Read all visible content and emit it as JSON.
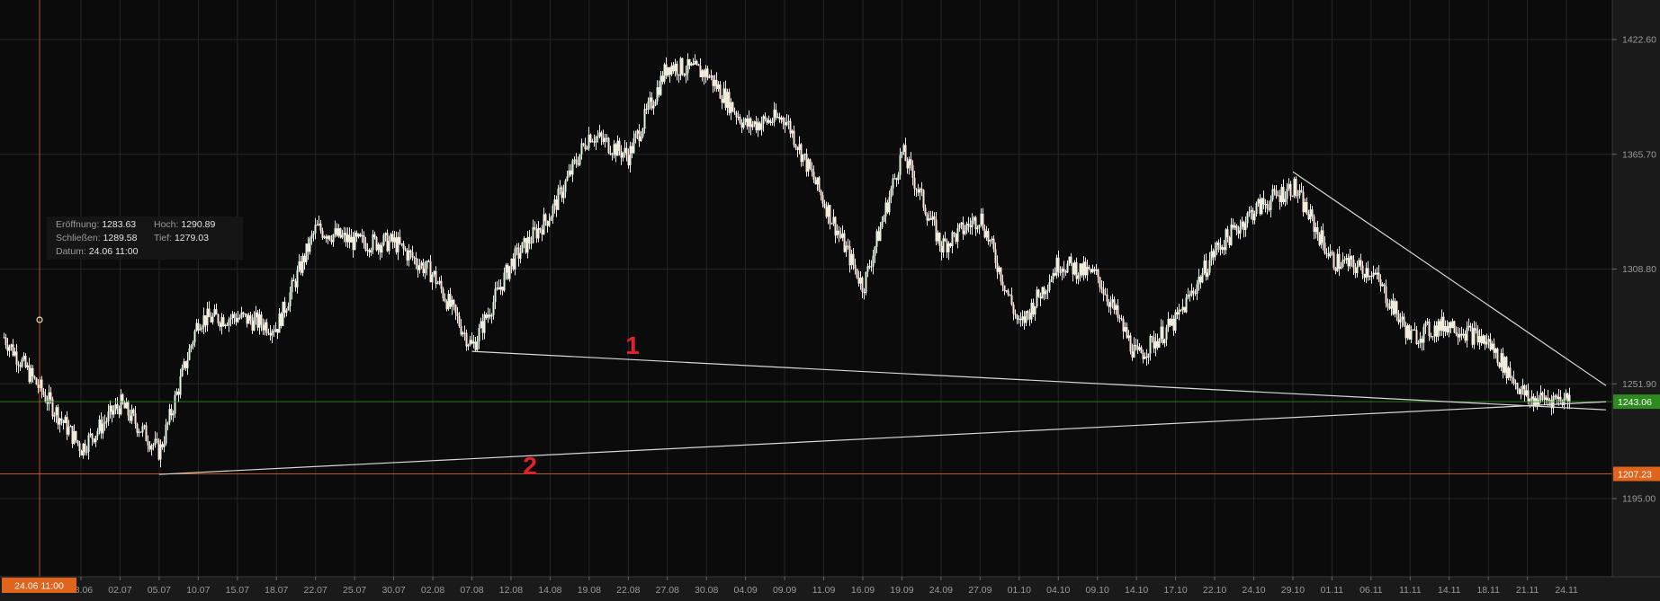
{
  "chart_data": {
    "type": "candlestick",
    "y_axis": {
      "ticks": [
        1422.6,
        1365.7,
        1308.8,
        1251.9,
        1195.0
      ],
      "tick_labels": [
        "1422.60",
        "1365.70",
        "1308.80",
        "1251.90",
        "1195.00"
      ],
      "range": [
        1171,
        1444
      ],
      "position": "right"
    },
    "x_axis": {
      "tick_labels": [
        "28.06",
        "02.07",
        "05.07",
        "10.07",
        "15.07",
        "18.07",
        "22.07",
        "25.07",
        "30.07",
        "02.08",
        "07.08",
        "12.08",
        "14.08",
        "19.08",
        "22.08",
        "27.08",
        "30.08",
        "04.09",
        "09.09",
        "11.09",
        "16.09",
        "19.09",
        "24.09",
        "27.09",
        "01.10",
        "04.10",
        "09.10",
        "14.10",
        "17.10",
        "22.10",
        "24.10",
        "29.10",
        "01.11",
        "06.11",
        "11.11",
        "14.11",
        "18.11",
        "21.11",
        "24.11"
      ],
      "crosshair_label": "24.06 11:00"
    },
    "price_series": {
      "dates": [
        "24.06",
        "28.06",
        "02.07",
        "05.07",
        "10.07",
        "15.07",
        "18.07",
        "22.07",
        "25.07",
        "30.07",
        "02.08",
        "07.08",
        "12.08",
        "14.08",
        "19.08",
        "22.08",
        "27.08",
        "30.08",
        "04.09",
        "09.09",
        "11.09",
        "16.09",
        "19.09",
        "24.09",
        "27.09",
        "01.10",
        "04.10",
        "09.10",
        "14.10",
        "17.10",
        "22.10",
        "24.10",
        "29.10",
        "01.11",
        "06.11",
        "11.11",
        "14.11",
        "18.11",
        "21.11",
        "23.11"
      ],
      "close": [
        1275,
        1220,
        1242,
        1218,
        1284,
        1285,
        1280,
        1329,
        1322,
        1322,
        1306,
        1270,
        1312,
        1336,
        1376,
        1365,
        1410,
        1406,
        1380,
        1384,
        1342,
        1300,
        1367,
        1320,
        1335,
        1280,
        1312,
        1305,
        1265,
        1283,
        1318,
        1338,
        1350,
        1313,
        1308,
        1275,
        1282,
        1272,
        1244,
        1245
      ]
    },
    "trendlines": [
      {
        "label": "1",
        "from": {
          "date": "07.08",
          "price": 1268
        },
        "to": {
          "date": "24.11",
          "price": 1239
        }
      },
      {
        "label": "2",
        "from": {
          "date": "05.07",
          "price": 1207
        },
        "to": {
          "date": "24.11",
          "price": 1243
        }
      },
      {
        "label": "",
        "from": {
          "date": "29.10",
          "price": 1357
        },
        "to": {
          "date": "24.11",
          "price": 1251
        }
      }
    ],
    "horizontal_levels": [
      {
        "value": 1243.06,
        "label": "1243.06",
        "color": "#2e8b1f"
      },
      {
        "value": 1207.23,
        "label": "1207.23",
        "color": "#e0641c"
      }
    ],
    "annotations": [
      "1",
      "2"
    ],
    "grid": true,
    "legend": "none"
  },
  "ohlc_panel": {
    "open_label": "Eröffnung:",
    "open_value": "1283.63",
    "high_label": "Hoch:",
    "high_value": "1290.89",
    "close_label": "Schließen:",
    "close_value": "1289.58",
    "low_label": "Tief:",
    "low_value": "1279.03",
    "date_label": "Datum:",
    "date_value": "24.06 11:00"
  },
  "colors": {
    "background": "#0b0b0b",
    "axis_panel": "#1a1a1a",
    "grid": "#262626",
    "candle_up": "#dff5df",
    "candle_down": "#ffe2d8",
    "trendline": "#d8d8d8",
    "annotation": "#e0232a",
    "crosshair": "#e0641c",
    "support_green": "#2e8b1f",
    "support_orange": "#e0641c"
  }
}
